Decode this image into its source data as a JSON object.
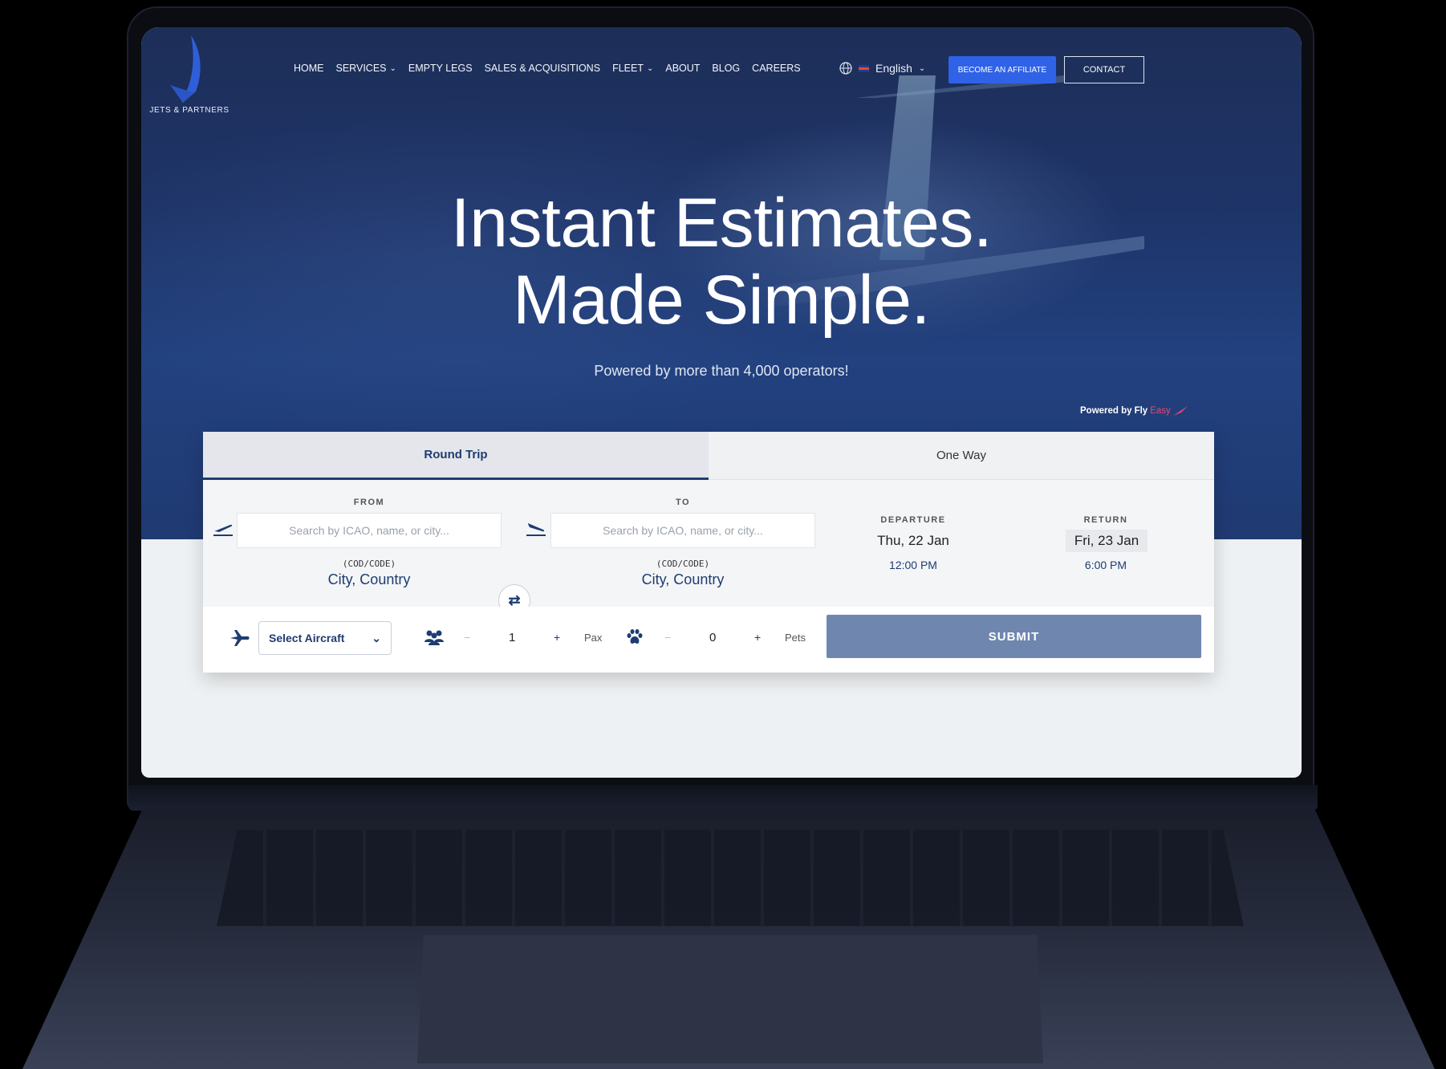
{
  "brand": {
    "logo_text": "JETS & PARTNERS"
  },
  "nav": {
    "items": [
      {
        "label": "HOME",
        "dropdown": false
      },
      {
        "label": "SERVICES",
        "dropdown": true
      },
      {
        "label": "EMPTY LEGS",
        "dropdown": false
      },
      {
        "label": "SALES & ACQUISITIONS",
        "dropdown": false
      },
      {
        "label": "FLEET",
        "dropdown": true
      },
      {
        "label": "ABOUT",
        "dropdown": false
      },
      {
        "label": "BLOG",
        "dropdown": false
      },
      {
        "label": "CAREERS",
        "dropdown": false
      }
    ],
    "language": "English",
    "affiliate_label": "BECOME AN AFFILIATE",
    "contact_label": "CONTACT"
  },
  "hero": {
    "line1": "Instant Estimates.",
    "line2": "Made Simple.",
    "subtitle": "Powered by more than 4,000 operators!",
    "powered_prefix": "Powered by",
    "powered_fly": "Fly",
    "powered_easy": "Easy"
  },
  "booking": {
    "tabs": {
      "round_trip": "Round Trip",
      "one_way": "One Way"
    },
    "from": {
      "label": "FROM",
      "placeholder": "Search by ICAO, name, or city...",
      "code": "(COD/CODE)",
      "city": "City, Country"
    },
    "to": {
      "label": "TO",
      "placeholder": "Search by ICAO, name, or city...",
      "code": "(COD/CODE)",
      "city": "City, Country"
    },
    "departure": {
      "label": "DEPARTURE",
      "date": "Thu, 22 Jan",
      "time": "12:00 PM"
    },
    "return": {
      "label": "RETURN",
      "date": "Fri, 23 Jan",
      "time": "6:00 PM"
    },
    "aircraft_select": "Select Aircraft",
    "pax": {
      "minus": "−",
      "value": "1",
      "plus": "+",
      "unit": "Pax"
    },
    "pets": {
      "minus": "−",
      "value": "0",
      "plus": "+",
      "unit": "Pets"
    },
    "submit_label": "SUBMIT"
  },
  "colors": {
    "accent": "#2f62e6",
    "navy": "#1e3c70",
    "submit": "#6f87ae",
    "flyeasy": "#e8486c"
  },
  "icons": [
    "globe-icon",
    "takeoff-icon",
    "landing-icon",
    "swap-icon",
    "plane-icon",
    "users-icon",
    "paw-icon",
    "chevron-down-icon"
  ]
}
